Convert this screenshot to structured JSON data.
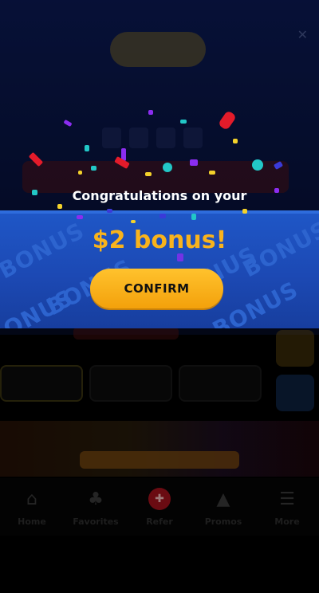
{
  "modal": {
    "line1": "Congratulations on your",
    "bonus": "$2 bonus!",
    "confirm_label": "CONFIRM",
    "watermark": "BONUS"
  },
  "nav": {
    "items": [
      {
        "label": "Home",
        "icon": "home-icon"
      },
      {
        "label": "Favorites",
        "icon": "gamepad-icon"
      },
      {
        "label": "Refer",
        "icon": "gift-icon"
      },
      {
        "label": "Promos",
        "icon": "promo-icon"
      },
      {
        "label": "More",
        "icon": "menu-icon"
      }
    ]
  },
  "colors": {
    "accent": "#f9b31c",
    "band": "#1f57c7",
    "nav_active": "#a3121d"
  }
}
